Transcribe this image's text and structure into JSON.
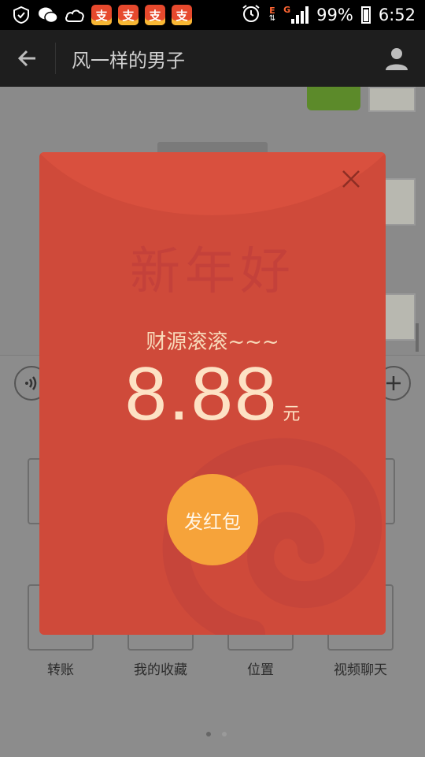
{
  "status_bar": {
    "battery": "99%",
    "time": "6:52",
    "net_e": "E",
    "net_g": "G",
    "app_badges": [
      "支",
      "支",
      "支",
      "支"
    ]
  },
  "header": {
    "title": "风一样的男子"
  },
  "packet": {
    "greeting": "新年好",
    "message": "财源滚滚~~~",
    "amount": "8.88",
    "unit": "元",
    "send_label": "发红包",
    "colors": {
      "background": "#cf4a3a",
      "button": "#f6a33a",
      "text": "#fde2c4"
    }
  },
  "panel": {
    "tiles": [
      {
        "label": "转账"
      },
      {
        "label": "我的收藏"
      },
      {
        "label": "位置"
      },
      {
        "label": "视频聊天"
      }
    ]
  }
}
